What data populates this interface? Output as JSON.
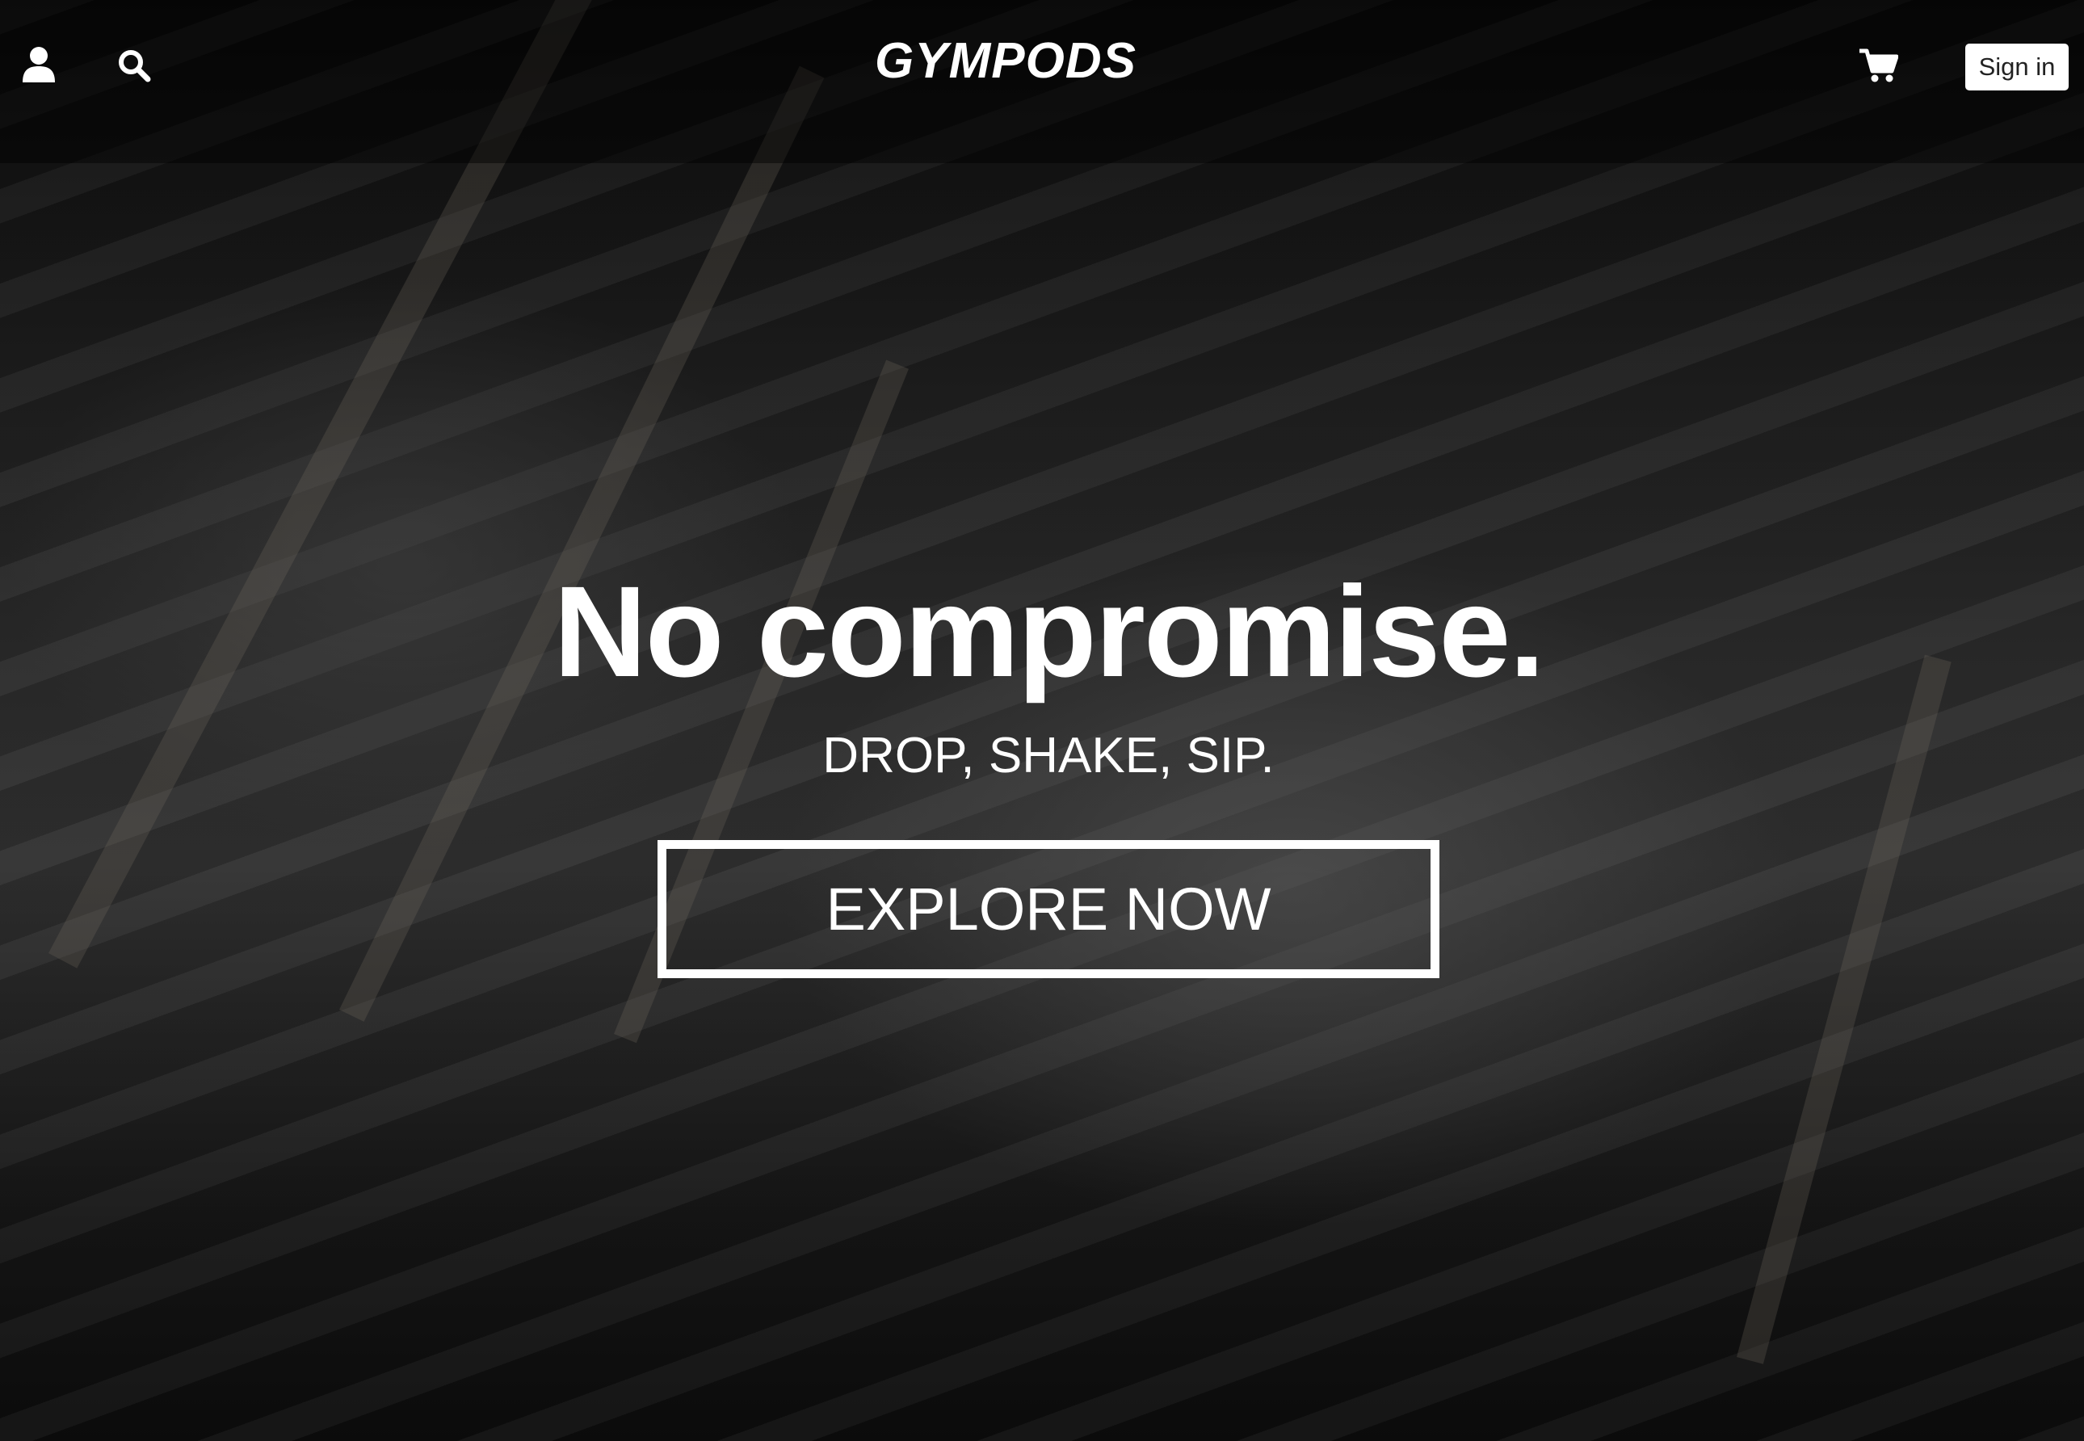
{
  "header": {
    "logo": "GYMPODS",
    "icons": [
      "user-icon",
      "search-icon",
      "cart-icon"
    ],
    "sign_in_label": "Sign in"
  },
  "hero": {
    "headline": "No compromise.",
    "subheadline": "DROP, SHAKE, SIP.",
    "cta_label": "EXPLORE NOW"
  },
  "colors": {
    "text": "#ffffff",
    "overlay": "#000000"
  }
}
